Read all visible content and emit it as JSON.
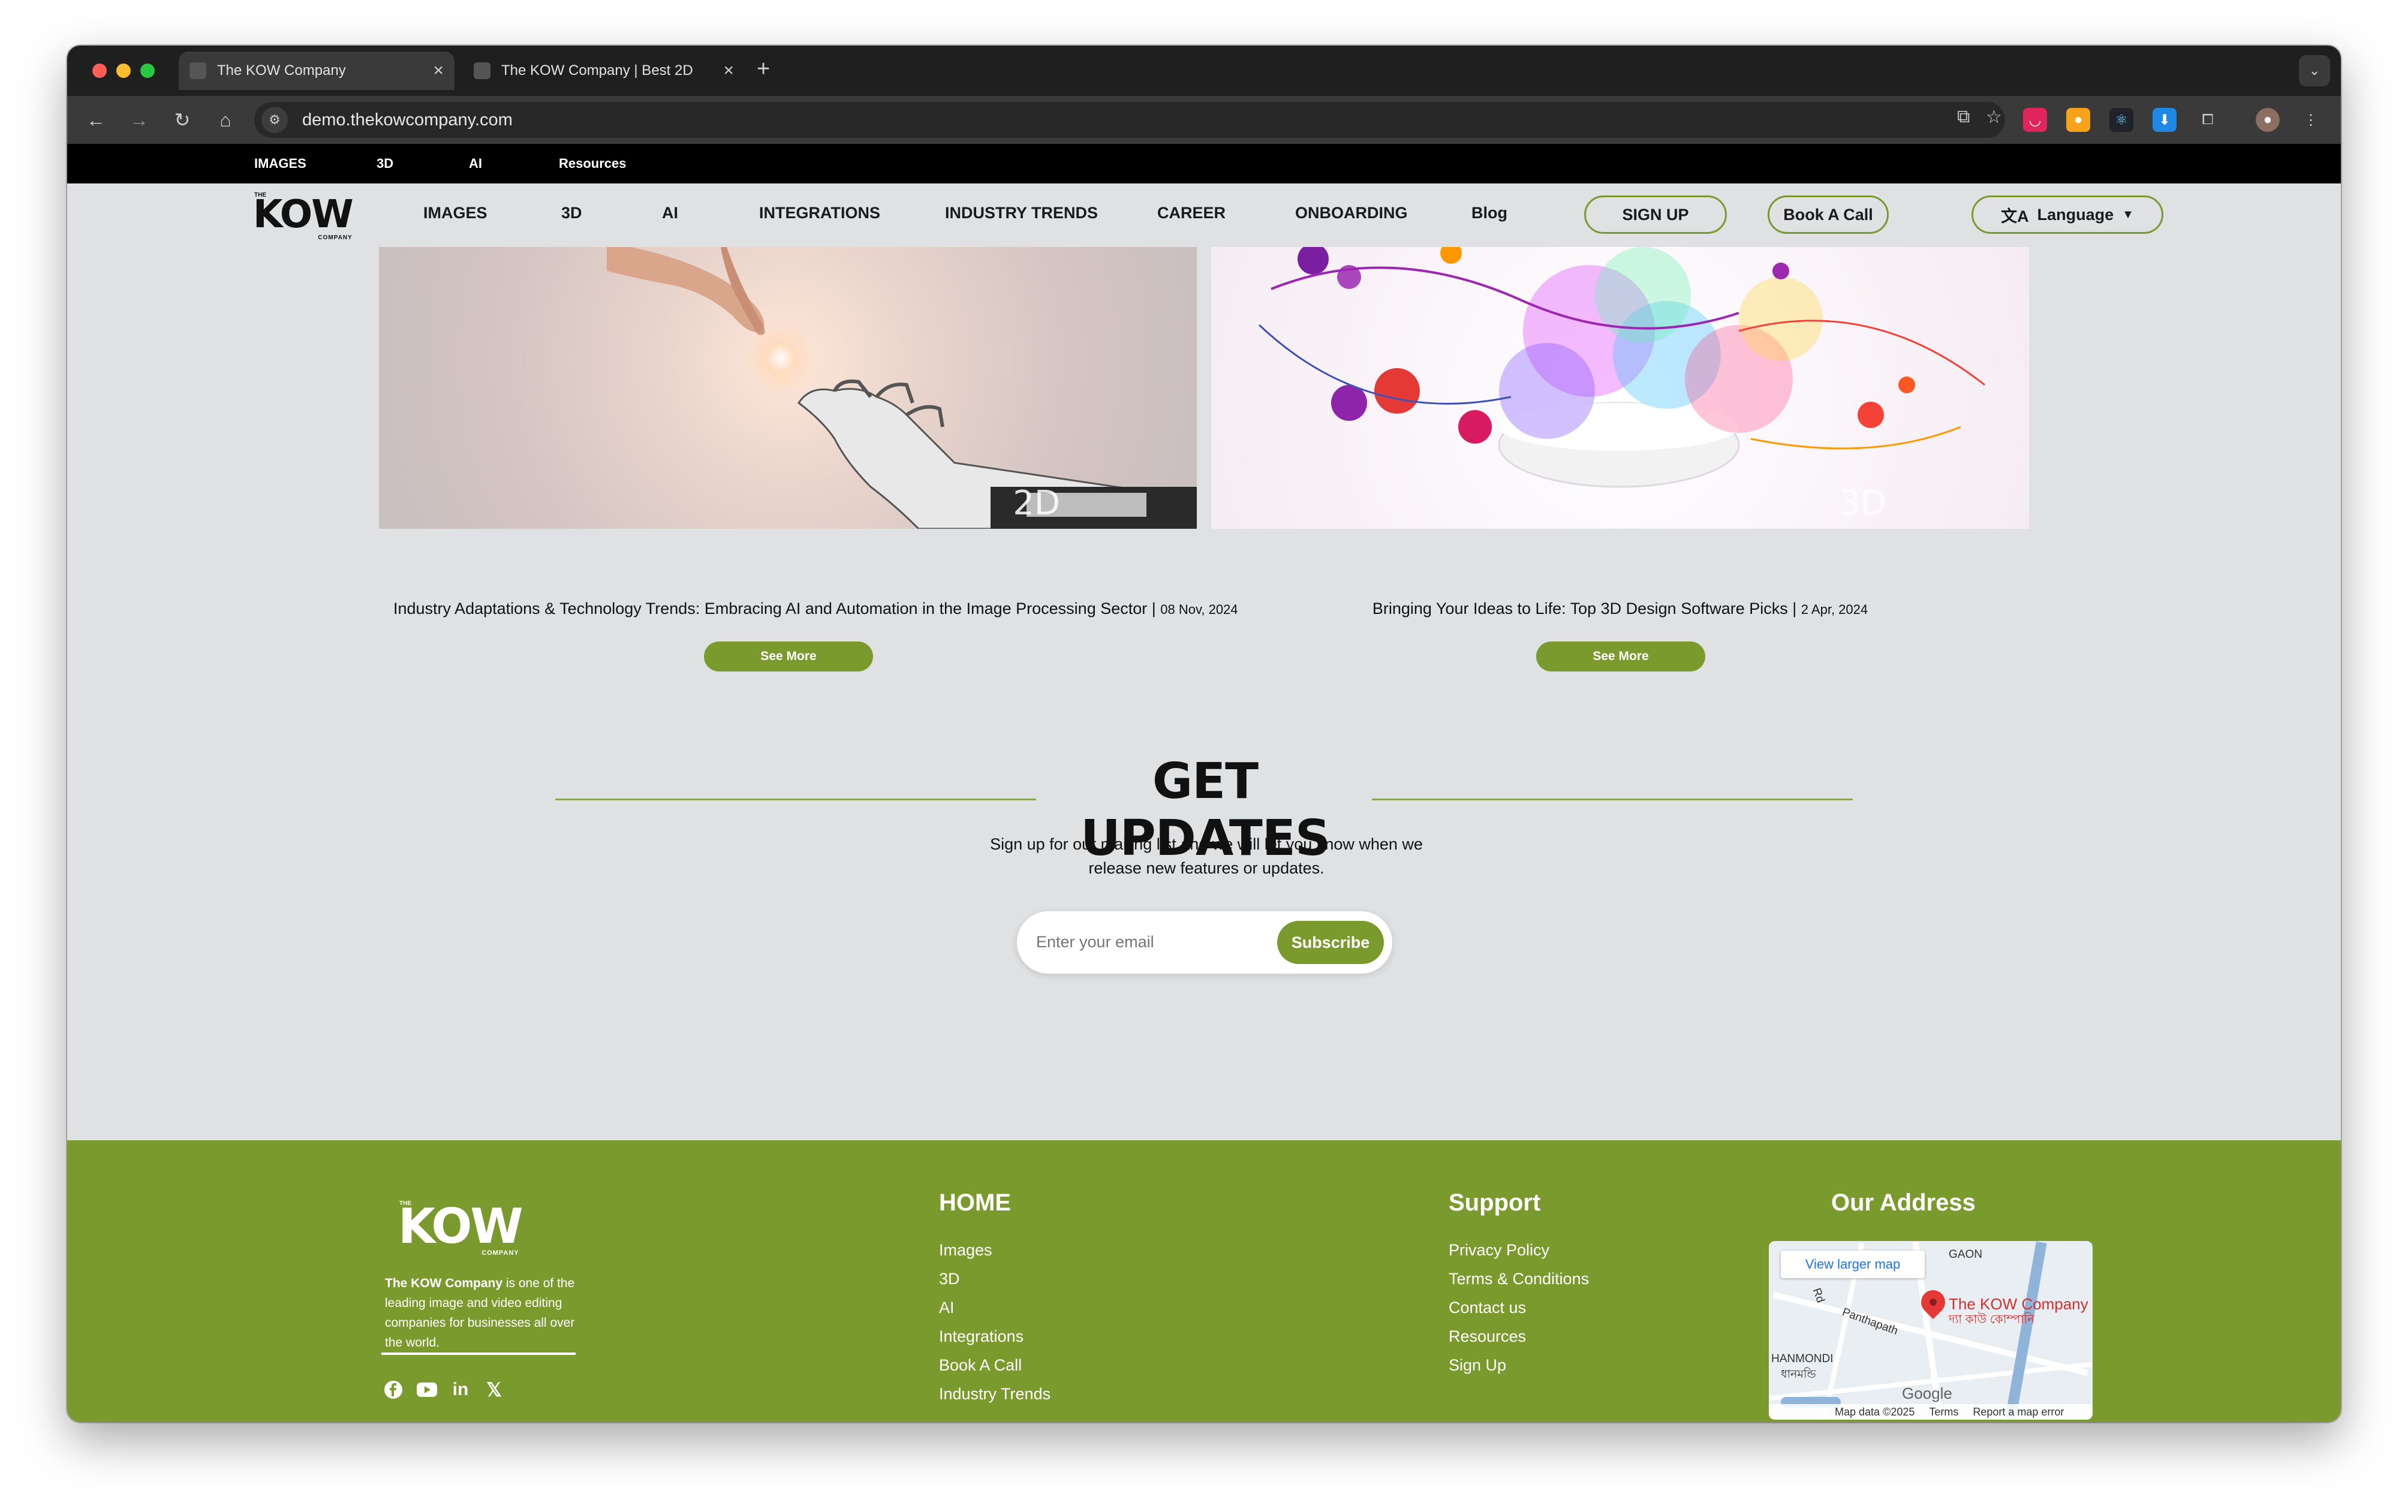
{
  "browser": {
    "tabs": [
      {
        "title": "The KOW Company",
        "close": "×"
      },
      {
        "title": "The KOW Company | Best 2D",
        "close": "×"
      }
    ],
    "new_tab": "+",
    "url": "demo.thekowcompany.com"
  },
  "topbar": {
    "links": [
      "IMAGES",
      "3D",
      "AI",
      "Resources"
    ]
  },
  "nav": {
    "logo": {
      "the": "THE",
      "kow": "KOW",
      "company": "COMPANY"
    },
    "links": [
      "IMAGES",
      "3D",
      "AI",
      "INTEGRATIONS",
      "INDUSTRY TRENDS",
      "CAREER",
      "ONBOARDING",
      "Blog"
    ],
    "signup": "SIGN UP",
    "book_call": "Book A Call",
    "language": "Language",
    "language_icon": "文A"
  },
  "cards": [
    {
      "image_tag": "2D",
      "title": "Industry Adaptations & Technology Trends: Embracing AI and Automation in the Image Processing Sector |",
      "date": "08 Nov, 2024",
      "button": "See More"
    },
    {
      "image_tag": "3D",
      "title": "Bringing Your Ideas to Life: Top 3D Design Software Picks |",
      "date": "2 Apr, 2024",
      "button": "See More"
    }
  ],
  "updates": {
    "title": "GET UPDATES",
    "text_line1": "Sign up for our mailing list and we will let you know when we",
    "text_line2": "release new features or updates.",
    "email_placeholder": "Enter your email",
    "subscribe": "Subscribe"
  },
  "footer": {
    "logo": {
      "the": "THE",
      "kow": "KOW",
      "company": "COMPANY"
    },
    "about_bold": "The KOW Company",
    "about_rest": " is one of the leading image and video editing companies for businesses all over the world.",
    "social": [
      "facebook-icon",
      "youtube-icon",
      "linkedin-icon",
      "x-icon"
    ],
    "home": {
      "heading": "HOME",
      "links": [
        "Images",
        "3D",
        "AI",
        "Integrations",
        "Book A Call",
        "Industry Trends"
      ]
    },
    "support": {
      "heading": "Support",
      "links": [
        "Privacy Policy",
        "Terms & Conditions",
        "Contact us",
        "Resources",
        "Sign Up"
      ]
    },
    "address": {
      "heading": "Our Address",
      "map": {
        "view_larger": "View larger map",
        "place": "The KOW Company",
        "place_local": "দ্যা কাউ কোম্পানি",
        "labels": [
          "GAON",
          "Panthapath",
          "HANMONDI",
          "ধানমন্ডি",
          "Rd"
        ],
        "google": "Google",
        "attribution": [
          "Map data ©2025",
          "Terms",
          "Report a map error"
        ]
      }
    }
  },
  "colors": {
    "brand_green": "#7b9a2e",
    "page_bg": "#dfe1e3"
  }
}
